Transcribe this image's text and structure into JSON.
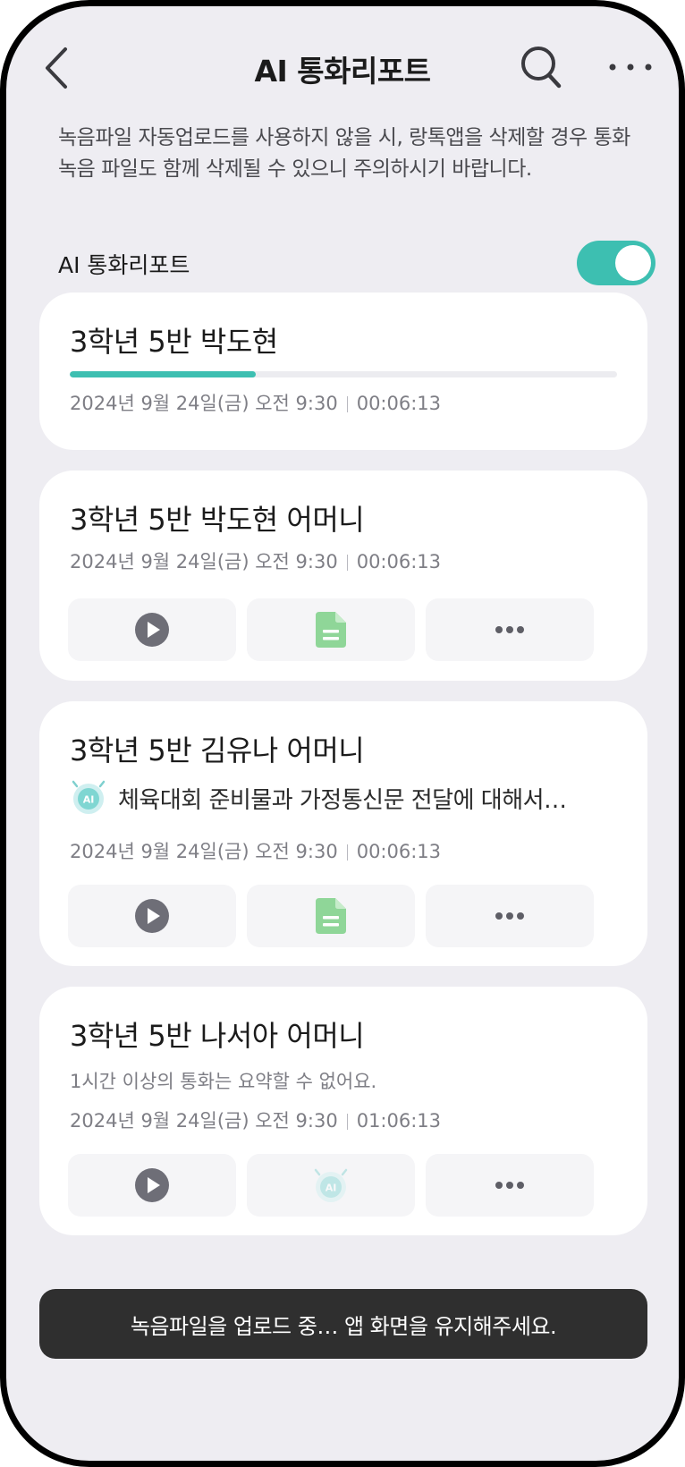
{
  "header": {
    "title": "AI 통화리포트"
  },
  "notice": "녹음파일 자동업로드를 사용하지 않을 시, 랑톡앱을 삭제할 경우 통화녹음 파일도 함께 삭제될 수 있으니 주의하시기 바랍니다.",
  "toggle": {
    "label": "AI 통화리포트",
    "on": true
  },
  "colors": {
    "accent": "#3dbfb1",
    "play": "#6e6e77",
    "doc": "#8fd698",
    "toast_bg": "#2f2f2f"
  },
  "cards": [
    {
      "title": "3학년 5반 박도현",
      "date": "2024년 9월 24일(금) 오전 9:30",
      "duration": "00:06:13",
      "upload_progress": 0.34
    },
    {
      "title": "3학년 5반 박도현 어머니",
      "date": "2024년 9월 24일(금) 오전 9:30",
      "duration": "00:06:13"
    },
    {
      "title": "3학년 5반 김유나 어머니",
      "summary": "체육대회 준비물과 가정통신문 전달에 대해서…",
      "ai_badge": "AI",
      "date": "2024년 9월 24일(금) 오전 9:30",
      "duration": "00:06:13"
    },
    {
      "title": "3학년 5반 나서아 어머니",
      "note": "1시간 이상의 통화는 요약할 수 없어요.",
      "ai_badge": "AI",
      "date": "2024년 9월 24일(금) 오전 9:30",
      "duration": "01:06:13"
    }
  ],
  "icons": {
    "back": "chevron-left-icon",
    "search": "search-icon",
    "more": "more-horizontal-icon",
    "play": "play-circle-icon",
    "document": "document-icon",
    "ai": "ai-robot-icon"
  },
  "toast": "녹음파일을 업로드 중… 앱 화면을 유지해주세요."
}
